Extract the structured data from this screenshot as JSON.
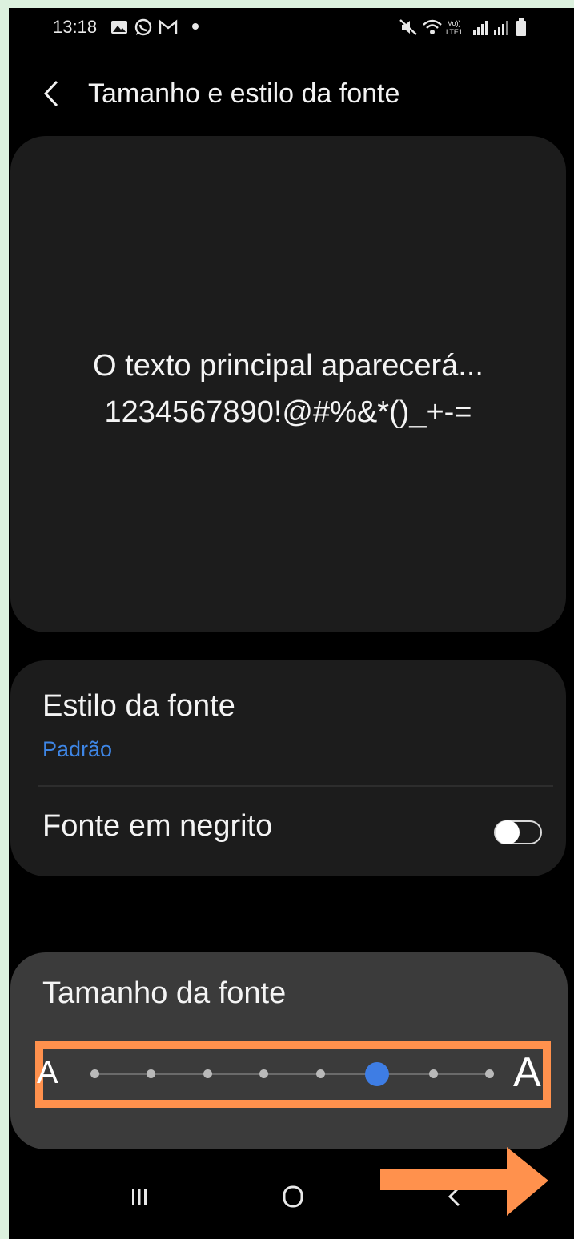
{
  "status_bar": {
    "time": "13:18",
    "left_icons": [
      "gallery-icon",
      "whatsapp-icon",
      "gmail-icon",
      "notification-dot"
    ],
    "right_icons": [
      "mute-icon",
      "wifi-icon",
      "volte-icon",
      "signal-icon",
      "signal-icon",
      "battery-icon"
    ],
    "volte_text_top": "Vo))",
    "volte_text_bottom": "LTE1"
  },
  "header": {
    "title": "Tamanho e estilo da fonte"
  },
  "preview": {
    "line1": "O texto principal aparecerá...",
    "line2": "1234567890!@#%&*()_+-="
  },
  "settings": {
    "font_style_label": "Estilo da fonte",
    "font_style_value": "Padrão",
    "bold_label": "Fonte em negrito",
    "bold_enabled": false
  },
  "font_size": {
    "label": "Tamanho da fonte",
    "small_glyph": "A",
    "large_glyph": "A",
    "steps": 8,
    "selected_step": 6
  },
  "colors": {
    "accent": "#3e86e6",
    "highlight": "#ff914d",
    "frame": "#dcf1de"
  },
  "nav_bar": {
    "buttons": [
      "recent-apps",
      "home",
      "back"
    ]
  }
}
